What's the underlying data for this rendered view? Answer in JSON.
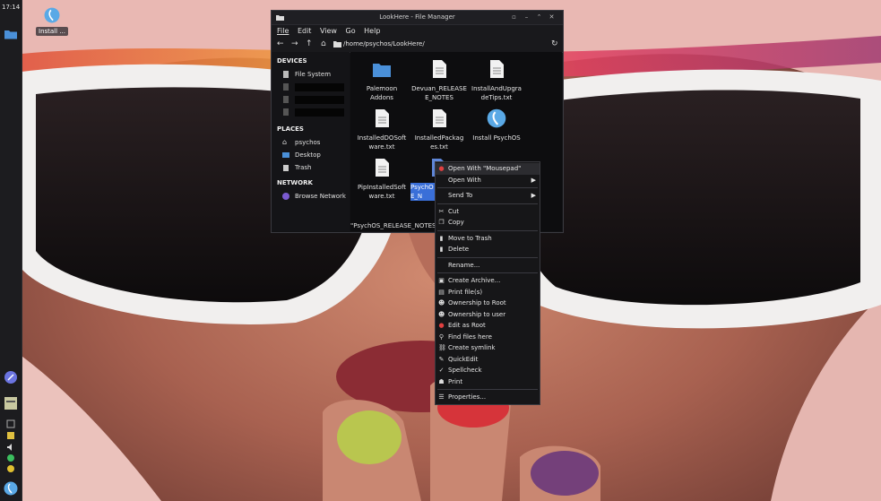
{
  "panel": {
    "clock": "17:14"
  },
  "desktop": {
    "install_icon_label": "Install ..."
  },
  "window": {
    "title": "LookHere - File Manager",
    "menu": [
      "File",
      "Edit",
      "View",
      "Go",
      "Help"
    ],
    "path": "/home/psychos/LookHere/",
    "sidebar": {
      "devices_heading": "DEVICES",
      "file_system": "File System",
      "places_heading": "PLACES",
      "places": [
        "psychos",
        "Desktop",
        "Trash"
      ],
      "network_heading": "NETWORK",
      "browse_network": "Browse Network"
    },
    "files": [
      {
        "name": "Palemoon\nAddons",
        "type": "folder"
      },
      {
        "name": "Devuan_RELEASE\nE_NOTES",
        "type": "doc"
      },
      {
        "name": "InstallAndUpgra\ndeTips.txt",
        "type": "doc"
      },
      {
        "name": "InstalledDOSoft\nware.txt",
        "type": "doc"
      },
      {
        "name": "InstalledPackag\nes.txt",
        "type": "doc"
      },
      {
        "name": "Install PsychOS",
        "type": "app"
      },
      {
        "name": "PipInstalledSoft\nware.txt",
        "type": "doc"
      },
      {
        "name": "PsychO\nE_N",
        "type": "doc"
      }
    ],
    "status": "\"PsychOS_RELEASE_NOTES"
  },
  "context_menu": {
    "items": [
      {
        "label": "Open With \"Mousepad\"",
        "icon": "mousepad-icon"
      },
      {
        "label": "Open With",
        "icon": "",
        "submenu": true
      },
      {
        "label": "Send To",
        "icon": "",
        "submenu": true
      },
      {
        "label": "Cut",
        "icon": "scissors-icon"
      },
      {
        "label": "Copy",
        "icon": "copy-icon"
      },
      {
        "label": "Move to Trash",
        "icon": "trash-icon"
      },
      {
        "label": "Delete",
        "icon": "delete-icon"
      },
      {
        "label": "Rename...",
        "icon": ""
      },
      {
        "label": "Create Archive...",
        "icon": "archive-icon"
      },
      {
        "label": "Print file(s)",
        "icon": "printer-icon"
      },
      {
        "label": "Ownership to Root",
        "icon": "user-icon"
      },
      {
        "label": "Ownership to user",
        "icon": "user-icon"
      },
      {
        "label": "Edit as Root",
        "icon": "edit-root-icon"
      },
      {
        "label": "Find files here",
        "icon": "search-icon"
      },
      {
        "label": "Create symlink",
        "icon": "link-icon"
      },
      {
        "label": "QuickEdit",
        "icon": "quickedit-icon"
      },
      {
        "label": "Spellcheck",
        "icon": "spellcheck-icon"
      },
      {
        "label": "Print",
        "icon": "print-icon"
      },
      {
        "label": "Properties...",
        "icon": "properties-icon"
      }
    ]
  }
}
